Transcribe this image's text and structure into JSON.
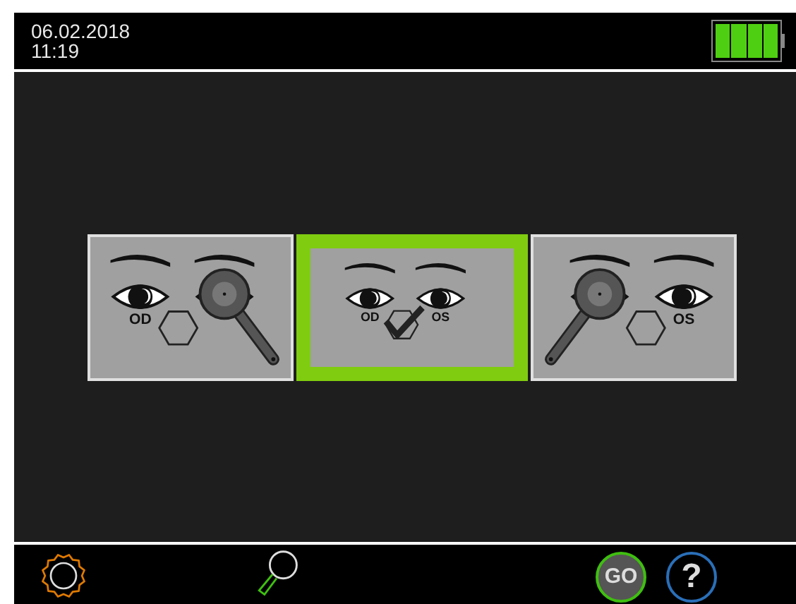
{
  "status_bar": {
    "date": "06.02.2018",
    "time": "11:19"
  },
  "options": [
    {
      "kind": "od",
      "label": "OD",
      "selected": false
    },
    {
      "kind": "both",
      "labels": [
        "OD",
        "OS"
      ],
      "selected": true
    },
    {
      "kind": "os",
      "label": "OS",
      "selected": false
    }
  ],
  "toolbar": {
    "go": "GO",
    "help": "?"
  }
}
